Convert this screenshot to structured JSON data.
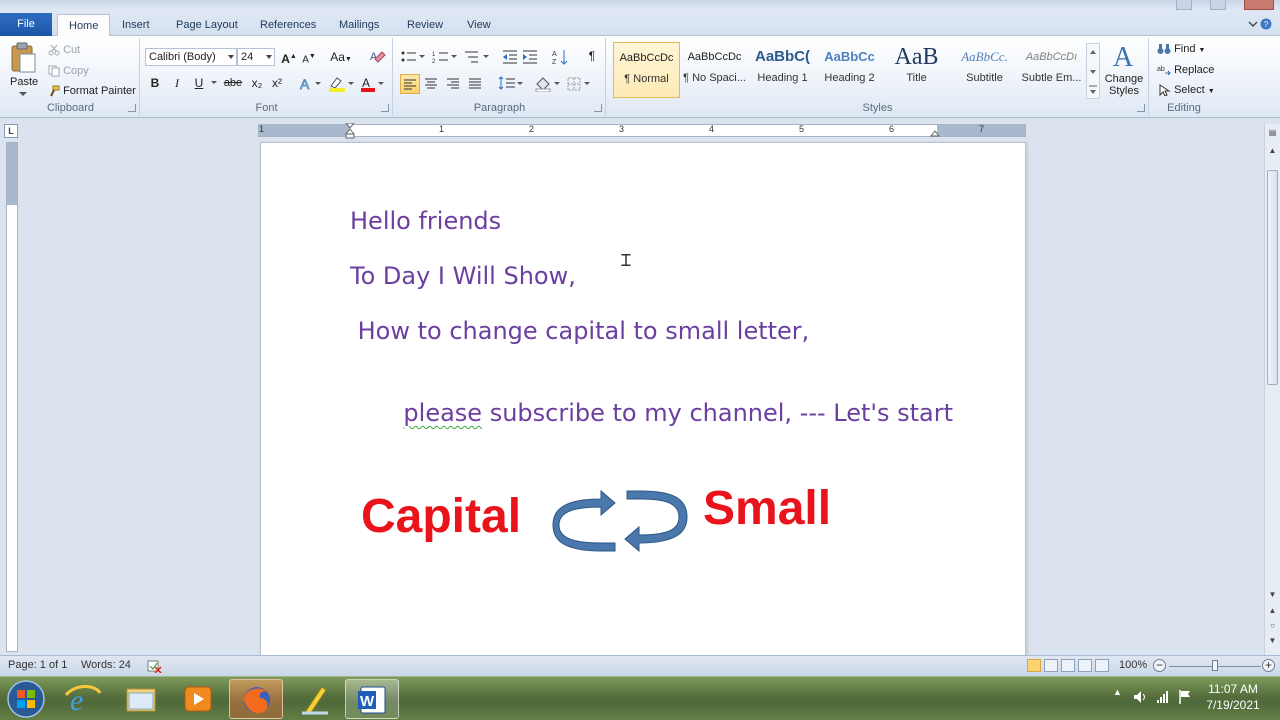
{
  "ribbon": {
    "tabs": [
      {
        "label": "File"
      },
      {
        "label": "Home"
      },
      {
        "label": "Insert"
      },
      {
        "label": "Page Layout"
      },
      {
        "label": "References"
      },
      {
        "label": "Mailings"
      },
      {
        "label": "Review"
      },
      {
        "label": "View"
      }
    ],
    "clipboard": {
      "paste": "Paste",
      "cut": "Cut",
      "copy": "Copy",
      "format_painter": "Format Painter",
      "label": "Clipboard"
    },
    "font": {
      "font_name": "Calibri (Body)",
      "font_size": "24",
      "label": "Font",
      "bold": "B",
      "italic": "I",
      "underline": "U",
      "strike": "abe",
      "subscript": "x₂",
      "superscript": "x²",
      "case": "Aa",
      "grow": "A",
      "shrink": "A"
    },
    "paragraph": {
      "label": "Paragraph",
      "pilcrow": "¶"
    },
    "styles": {
      "label": "Styles",
      "items": [
        {
          "sample": "AaBbCcDc",
          "name": "¶ Normal"
        },
        {
          "sample": "AaBbCcDc",
          "name": "¶ No Spaci..."
        },
        {
          "sample": "AaBbC(",
          "name": "Heading 1"
        },
        {
          "sample": "AaBbCc",
          "name": "Heading 2"
        },
        {
          "sample": "AaB",
          "name": "Title"
        },
        {
          "sample": "AaBbCc.",
          "name": "Subtitle"
        },
        {
          "sample": "AaBbCcDı",
          "name": "Subtle Em..."
        }
      ],
      "change_styles": "Change Styles"
    },
    "editing": {
      "label": "Editing",
      "find": "Find",
      "replace": "Replace",
      "select": "Select"
    }
  },
  "ruler": {
    "corner": "L",
    "numbers": [
      "1",
      "1",
      "2",
      "3",
      "4",
      "5",
      "6",
      "7"
    ]
  },
  "document": {
    "lines": [
      "Hello friends",
      "To Day I Will Show,",
      " How to change capital to small letter,",
      "please",
      " subscribe to my channel, --- Let's start"
    ],
    "graphic": {
      "left_word": "Capital",
      "right_word": "Small",
      "arrow_color": "#4a78ad",
      "word_color": "#e8131b"
    },
    "text_color": "#6b3fa0"
  },
  "statusbar": {
    "page": "Page: 1 of 1",
    "words": "Words: 24",
    "zoom": "100%",
    "zoom_level": 1.0
  },
  "taskbar": {
    "apps": [
      "start-orb",
      "internet-explorer",
      "file-explorer",
      "media-player",
      "firefox",
      "paint-pencil",
      "microsoft-word"
    ],
    "clock_time": "11:07 AM",
    "clock_date": "7/19/2021"
  }
}
